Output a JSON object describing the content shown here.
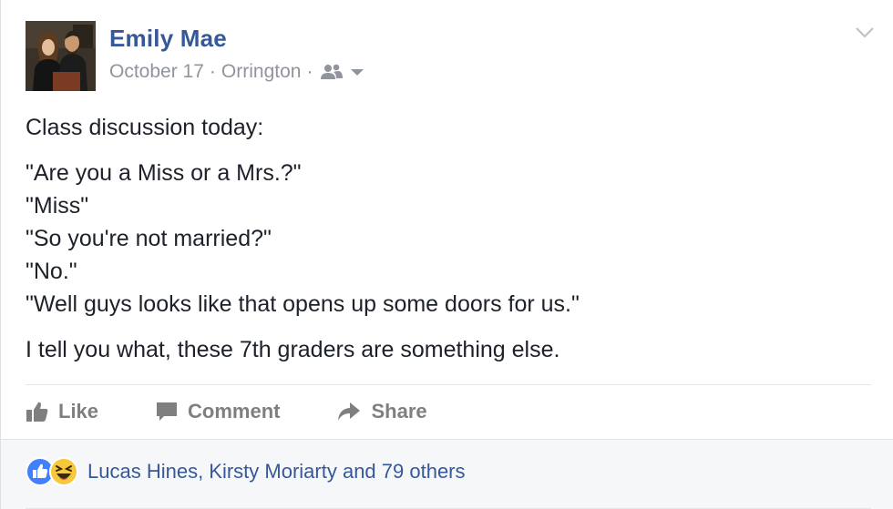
{
  "post": {
    "author": "Emily Mae",
    "date": "October 17",
    "location": "Orrington",
    "meta_separator": "·",
    "audience_icon": "friends-icon",
    "menu_icon": "chevron-down-icon",
    "body": {
      "intro": "Class discussion today:",
      "dialogue": [
        "\"Are you a Miss or a Mrs.?\"",
        "\"Miss\"",
        "\"So you're not married?\"",
        "\"No.\"",
        "\"Well guys looks like that opens up some doors for us.\""
      ],
      "closing": "I tell you what, these 7th graders are something else."
    },
    "actions": {
      "like_label": "Like",
      "comment_label": "Comment",
      "share_label": "Share"
    },
    "reactions": {
      "icons": [
        "like-reaction-icon",
        "haha-reaction-icon"
      ],
      "summary": "Lucas Hines, Kirsty Moriarty and 79 others"
    }
  },
  "colors": {
    "author_link": "#365899",
    "meta_gray": "#90949c",
    "text": "#1d2129",
    "action_gray": "#7f7f7f",
    "like_blue": "#4080ff",
    "haha_yellow": "#f7c73c",
    "footer_bg": "#f6f7f9"
  }
}
